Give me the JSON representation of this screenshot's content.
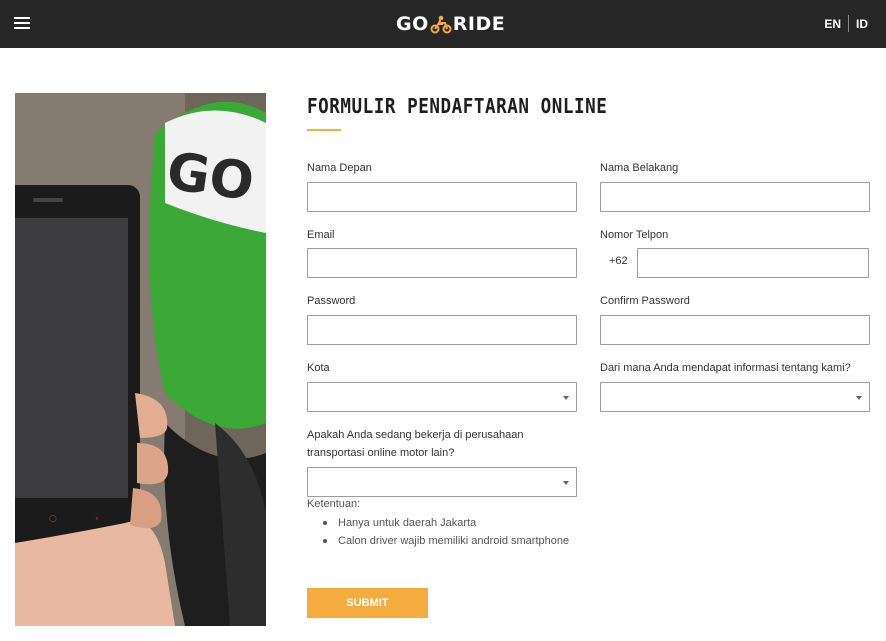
{
  "header": {
    "menu_icon": "hamburger-icon",
    "logo_left": "GO",
    "logo_right": "RIDE",
    "logo_icon": "motorbike-rider-icon",
    "lang_en": "EN",
    "lang_id": "ID"
  },
  "hero_image": {
    "description_icon": "phone-in-hand-photo"
  },
  "form": {
    "title": "FORMULIR PENDAFTARAN ONLINE",
    "fields": {
      "first_name": {
        "label": "Nama Depan",
        "value": ""
      },
      "last_name": {
        "label": "Nama Belakang",
        "value": ""
      },
      "email": {
        "label": "Email",
        "value": ""
      },
      "phone": {
        "label": "Nomor Telpon",
        "prefix": "+62",
        "value": ""
      },
      "password": {
        "label": "Password",
        "value": ""
      },
      "confirm_password": {
        "label": "Confirm Password",
        "value": ""
      },
      "city": {
        "label": "Kota",
        "value": ""
      },
      "source": {
        "label": "Dari mana Anda mendapat informasi tentang kami?",
        "value": ""
      },
      "other_company": {
        "label_line1": "Apakah Anda sedang bekerja di perusahaan",
        "label_line2": "transportasi online motor lain?",
        "value": ""
      }
    },
    "terms": {
      "label": "Ketentuan:",
      "items": [
        "Hanya untuk daerah Jakarta",
        "Calon driver wajib memiliki android smartphone"
      ]
    },
    "submit_label": "SUBMIT"
  },
  "colors": {
    "header_bg": "#262626",
    "accent": "#f4ac3e",
    "brand_green": "#3aa935"
  }
}
